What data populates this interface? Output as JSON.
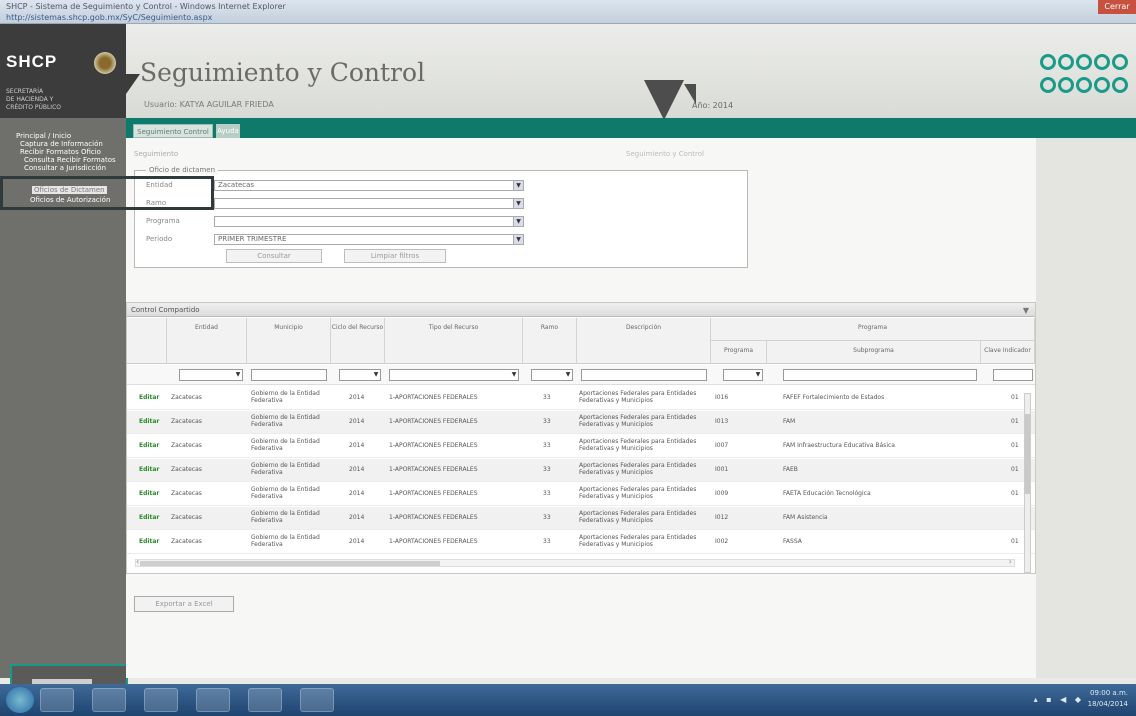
{
  "window": {
    "title": "SHCP - Sistema de Seguimiento y Control - Windows Internet Explorer",
    "url": "http://sistemas.shcp.gob.mx/SyC/Seguimiento.aspx",
    "close_label": "Cerrar"
  },
  "header": {
    "logo": "SHCP",
    "logo_sub": "SECRETARÍA\nDE HACIENDA Y\nCRÉDITO PÚBLICO",
    "title": "Seguimiento y Control",
    "subtitle": "Usuario: KATYA AGUILAR FRIEDA",
    "year": "Año: 2014"
  },
  "tabs": [
    {
      "label": "Seguimiento Control"
    },
    {
      "label": "Ayuda"
    }
  ],
  "sidebar": {
    "items": [
      {
        "label": "Principal / Inicio"
      },
      {
        "label": "Captura de Información"
      },
      {
        "label": "Recibir Formatos Oficio"
      },
      {
        "label": "Consulta Recibir Formatos"
      },
      {
        "label": "Consultar a Jurisdicción"
      },
      {
        "label": "Oficios de Dictamen"
      },
      {
        "label": "Oficios de Autorización"
      }
    ]
  },
  "breadcrumb": "Seguimiento",
  "center_crumb": "Seguimiento y Control",
  "filter": {
    "legend": "Oficio de dictamen",
    "fields": [
      {
        "label": "Entidad",
        "value": "Zacatecas"
      },
      {
        "label": "Ramo",
        "value": ""
      },
      {
        "label": "Programa",
        "value": ""
      },
      {
        "label": "Periodo",
        "value": "PRIMER TRIMESTRE"
      }
    ],
    "search_label": "Consultar",
    "clear_label": "Limpiar filtros"
  },
  "grid": {
    "caption": "Control Compartido",
    "headers": [
      "Entidad",
      "Municipio",
      "Ciclo del Recurso",
      "Tipo del Recurso",
      "Ramo",
      "Descripción",
      "Programa",
      "Subprograma",
      "Clave Indicador"
    ],
    "group_header": "Programa",
    "rows": [
      {
        "action": "Editar",
        "entidad": "Zacatecas",
        "municipio": "Gobierno de la Entidad Federativa",
        "ciclo": "2014",
        "tipo": "1-APORTACIONES FEDERALES",
        "ramo": "33",
        "descripcion": "Aportaciones Federales para Entidades Federativas y Municipios",
        "programa": "I016",
        "programa_desc": "FAFEF Fortalecimiento de Estados",
        "extra": "01"
      },
      {
        "action": "Editar",
        "entidad": "Zacatecas",
        "municipio": "Gobierno de la Entidad Federativa",
        "ciclo": "2014",
        "tipo": "1-APORTACIONES FEDERALES",
        "ramo": "33",
        "descripcion": "Aportaciones Federales para Entidades Federativas y Municipios",
        "programa": "I013",
        "programa_desc": "FAM",
        "extra": "01"
      },
      {
        "action": "Editar",
        "entidad": "Zacatecas",
        "municipio": "Gobierno de la Entidad Federativa",
        "ciclo": "2014",
        "tipo": "1-APORTACIONES FEDERALES",
        "ramo": "33",
        "descripcion": "Aportaciones Federales para Entidades Federativas y Municipios",
        "programa": "I007",
        "programa_desc": "FAM Infraestructura Educativa Básica",
        "extra": "01"
      },
      {
        "action": "Editar",
        "entidad": "Zacatecas",
        "municipio": "Gobierno de la Entidad Federativa",
        "ciclo": "2014",
        "tipo": "1-APORTACIONES FEDERALES",
        "ramo": "33",
        "descripcion": "Aportaciones Federales para Entidades Federativas y Municipios",
        "programa": "I001",
        "programa_desc": "FAEB",
        "extra": "01"
      },
      {
        "action": "Editar",
        "entidad": "Zacatecas",
        "municipio": "Gobierno de la Entidad Federativa",
        "ciclo": "2014",
        "tipo": "1-APORTACIONES FEDERALES",
        "ramo": "33",
        "descripcion": "Aportaciones Federales para Entidades Federativas y Municipios",
        "programa": "I009",
        "programa_desc": "FAETA Educación Tecnológica",
        "extra": "01"
      },
      {
        "action": "Editar",
        "entidad": "Zacatecas",
        "municipio": "Gobierno de la Entidad Federativa",
        "ciclo": "2014",
        "tipo": "1-APORTACIONES FEDERALES",
        "ramo": "33",
        "descripcion": "Aportaciones Federales para Entidades Federativas y Municipios",
        "programa": "I012",
        "programa_desc": "FAM Asistencia",
        "extra": ""
      },
      {
        "action": "Editar",
        "entidad": "Zacatecas",
        "municipio": "Gobierno de la Entidad Federativa",
        "ciclo": "2014",
        "tipo": "1-APORTACIONES FEDERALES",
        "ramo": "33",
        "descripcion": "Aportaciones Federales para Entidades Federativas y Municipios",
        "programa": "I002",
        "programa_desc": "FASSA",
        "extra": "01"
      }
    ]
  },
  "export_label": "Exportar a Excel",
  "tray": {
    "time": "09:00 a.m.",
    "date": "18/04/2014"
  }
}
